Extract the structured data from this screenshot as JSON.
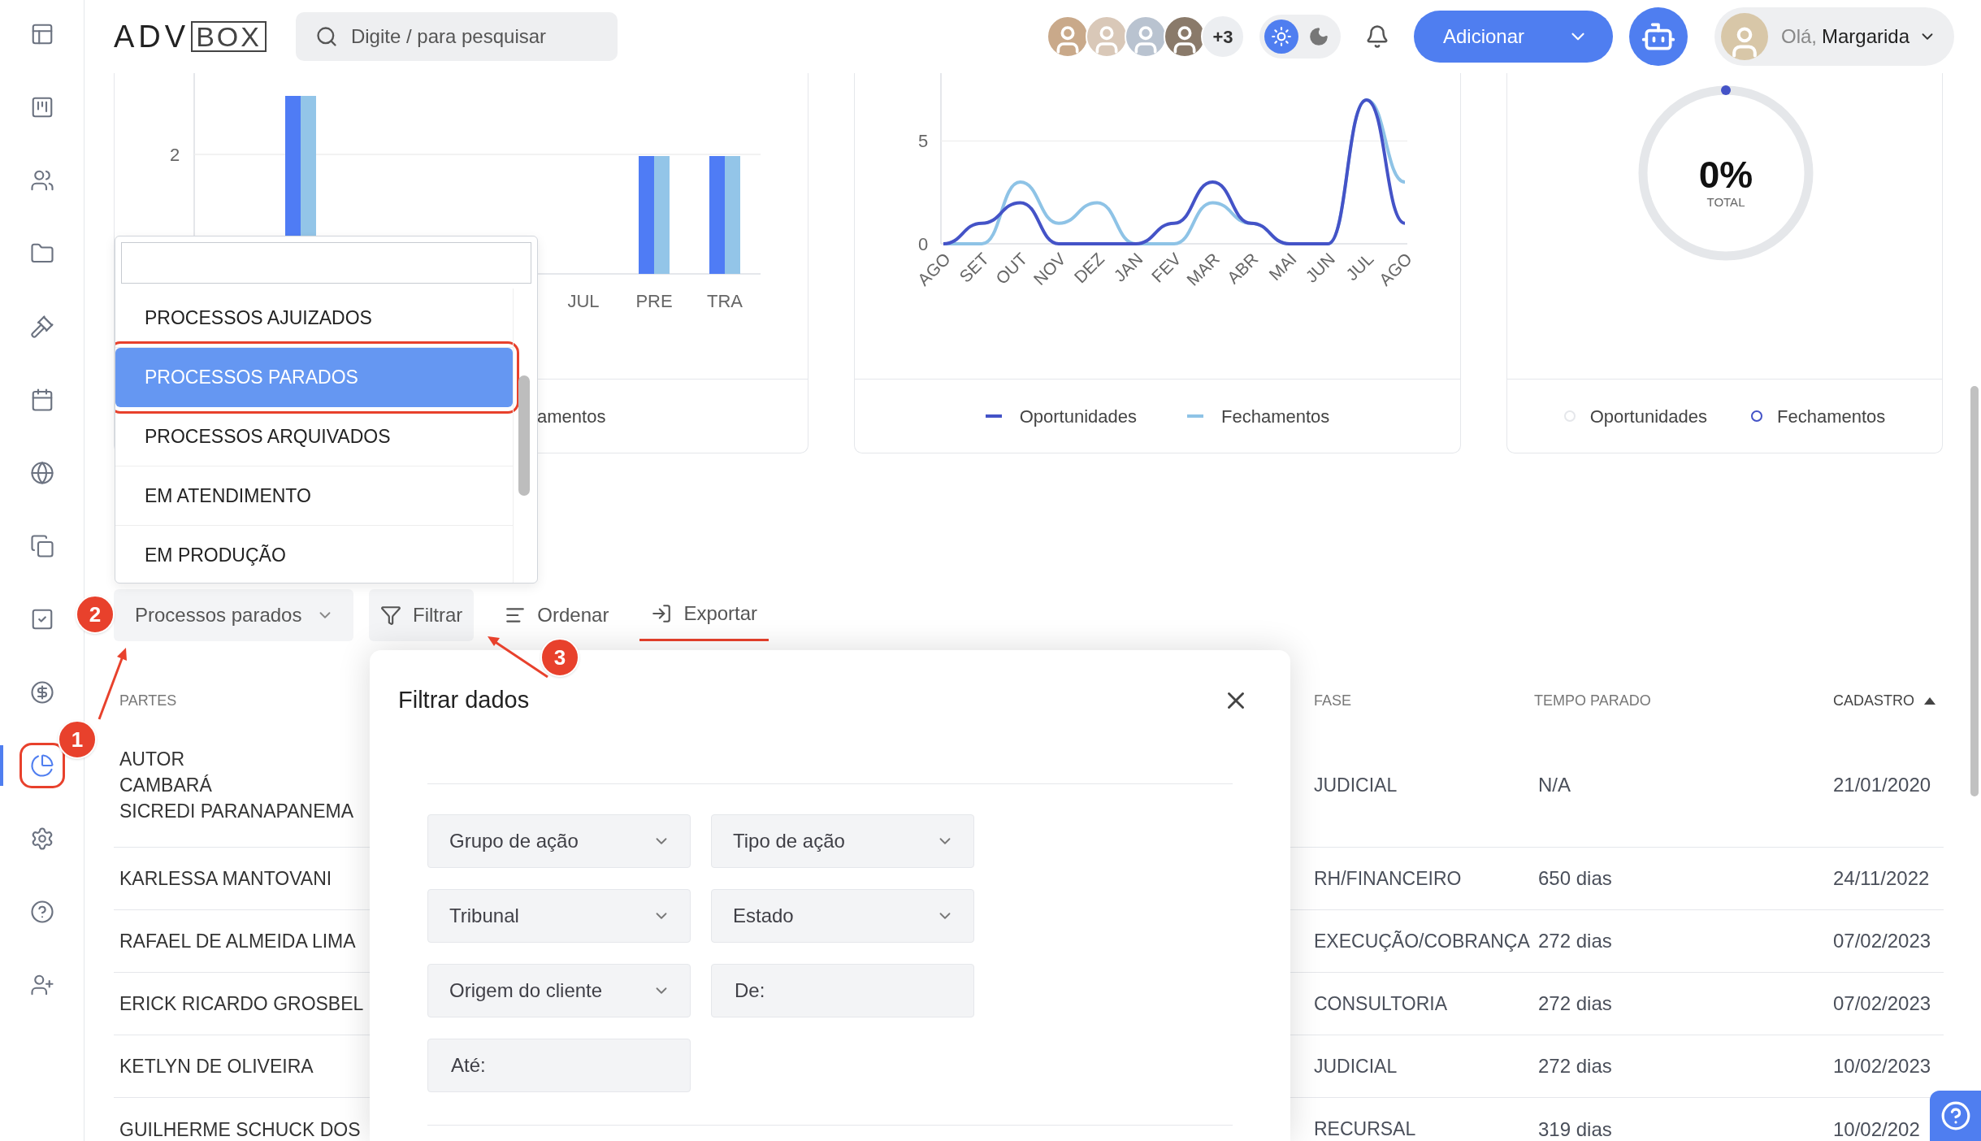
{
  "header": {
    "logo": {
      "left": "ADV",
      "right": "BOX"
    },
    "search": {
      "placeholder": "Digite / para pesquisar"
    },
    "team": {
      "extra_count": "+3"
    },
    "theme_toggle": {
      "dark": false
    },
    "add_button": {
      "label": "Adicionar"
    },
    "user": {
      "greeting": "Olá,",
      "name": "Margarida"
    }
  },
  "sidebar": {
    "items": [
      {
        "selected": false,
        "highlighted": false
      },
      {
        "selected": false,
        "highlighted": false
      },
      {
        "selected": false,
        "highlighted": false
      },
      {
        "selected": false,
        "highlighted": false
      },
      {
        "selected": false,
        "highlighted": false
      },
      {
        "selected": false,
        "highlighted": false
      },
      {
        "selected": false,
        "highlighted": false
      },
      {
        "selected": false,
        "highlighted": false
      },
      {
        "selected": false,
        "highlighted": false
      },
      {
        "selected": false,
        "highlighted": false
      },
      {
        "selected": true,
        "highlighted": true
      },
      {
        "selected": false,
        "highlighted": false
      },
      {
        "selected": false,
        "highlighted": false
      },
      {
        "selected": false,
        "highlighted": false
      }
    ]
  },
  "bar_card": {
    "y_tick": "2",
    "x_labels": [
      "JUL",
      "PRE",
      "TRA"
    ],
    "legend_fragment": "amentos"
  },
  "line_card": {
    "chart_data": {
      "type": "line",
      "categories": [
        "AGO",
        "SET",
        "OUT",
        "NOV",
        "DEZ",
        "JAN",
        "FEV",
        "MAR",
        "ABR",
        "MAI",
        "JUN",
        "JUL",
        "AGO"
      ],
      "yticks": [
        0,
        5
      ],
      "ylim": [
        0,
        8.3
      ],
      "series": [
        {
          "name": "Oportunidades",
          "color": "#4453c7",
          "values": [
            0,
            1,
            2,
            0,
            0,
            0,
            1,
            3,
            1,
            0,
            0,
            7,
            1
          ]
        },
        {
          "name": "Fechamentos",
          "color": "#8ec3e6",
          "values": [
            0,
            0,
            3,
            1,
            2,
            0,
            0,
            2,
            1,
            0,
            0,
            7,
            3
          ]
        }
      ]
    }
  },
  "total_card": {
    "value": "0%",
    "label": "TOTAL",
    "legend": [
      {
        "label": "Oportunidades",
        "color": "#e5e7eb"
      },
      {
        "label": "Fechamentos",
        "color": "#4453c7"
      }
    ]
  },
  "view_dropdown": {
    "items": [
      {
        "label": "PROCESSOS AJUIZADOS",
        "selected": false,
        "highlighted": false
      },
      {
        "label": "PROCESSOS PARADOS",
        "selected": true,
        "highlighted": true
      },
      {
        "label": "PROCESSOS ARQUIVADOS",
        "selected": false,
        "highlighted": false
      },
      {
        "label": "EM ATENDIMENTO",
        "selected": false,
        "highlighted": false
      },
      {
        "label": "EM PRODUÇÃO",
        "selected": false,
        "highlighted": false
      }
    ]
  },
  "toolbar": {
    "view_select": {
      "label": "Processos parados"
    },
    "buttons": [
      {
        "kind": "filter",
        "label": "Filtrar",
        "active": true,
        "highlighted": false
      },
      {
        "kind": "sort",
        "label": "Ordenar",
        "active": false,
        "highlighted": false
      },
      {
        "kind": "export",
        "label": "Exportar",
        "active": false,
        "highlighted": true
      }
    ]
  },
  "annotations": [
    {
      "label": "1"
    },
    {
      "label": "2"
    },
    {
      "label": "3"
    }
  ],
  "table": {
    "columns": [
      {
        "label": "PARTES",
        "sorted_ascending": false
      },
      {
        "label": "FASE",
        "sorted_ascending": false
      },
      {
        "label": "TEMPO PARADO",
        "sorted_ascending": false
      },
      {
        "label": "CADASTRO",
        "sorted_ascending": true
      }
    ],
    "rows": [
      {
        "parties": [
          "AUTOR",
          "CAMBARÁ",
          "SICREDI PARANAPANEMA"
        ],
        "phase": "JUDICIAL",
        "idle_time": "N/A",
        "registered": "21/01/2020"
      },
      {
        "parties": [
          "KARLESSA MANTOVANI"
        ],
        "phase": "RH/FINANCEIRO",
        "idle_time": "650 dias",
        "registered": "24/11/2022"
      },
      {
        "parties": [
          "RAFAEL DE ALMEIDA LIMA"
        ],
        "phase": "EXECUÇÃO/COBRANÇA",
        "idle_time": "272 dias",
        "registered": "07/02/2023"
      },
      {
        "parties": [
          "ERICK RICARDO GROSBEL"
        ],
        "phase": "CONSULTORIA",
        "idle_time": "272 dias",
        "registered": "07/02/2023"
      },
      {
        "parties": [
          "KETLYN DE OLIVEIRA"
        ],
        "phase": "JUDICIAL",
        "idle_time": "272 dias",
        "registered": "10/02/2023"
      },
      {
        "parties": [
          "GUILHERME SCHUCK DOS"
        ],
        "phase": "RECURSAL",
        "idle_time": "319 dias",
        "registered": "10/02/202"
      }
    ]
  },
  "filter_modal": {
    "title": "Filtrar dados",
    "fields": [
      {
        "kind": "select",
        "placeholder": "Grupo de ação"
      },
      {
        "kind": "select",
        "placeholder": "Tipo de ação"
      },
      {
        "kind": "select",
        "placeholder": "Tribunal"
      },
      {
        "kind": "select",
        "placeholder": "Estado"
      },
      {
        "kind": "select",
        "placeholder": "Origem do cliente"
      },
      {
        "kind": "date",
        "placeholder": "De:"
      },
      {
        "kind": "date",
        "placeholder": "Até:"
      }
    ]
  }
}
